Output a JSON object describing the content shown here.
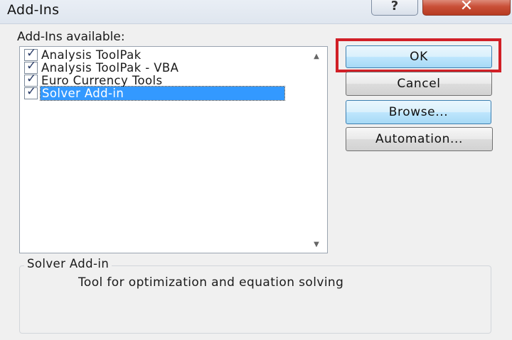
{
  "window": {
    "title": "Add-Ins",
    "help_glyph": "?",
    "close_glyph": "✕"
  },
  "addins": {
    "label": "Add-Ins available:",
    "items": [
      {
        "label": "Analysis ToolPak",
        "checked": true,
        "selected": false
      },
      {
        "label": "Analysis ToolPak - VBA",
        "checked": true,
        "selected": false
      },
      {
        "label": "Euro Currency Tools",
        "checked": true,
        "selected": false
      },
      {
        "label": "Solver Add-in",
        "checked": true,
        "selected": true
      }
    ],
    "check_glyph": "✓",
    "scroll_up_glyph": "▲",
    "scroll_down_glyph": "▼"
  },
  "buttons": {
    "ok": "OK",
    "cancel": "Cancel",
    "browse": "Browse...",
    "automation": "Automation..."
  },
  "description": {
    "title": "Solver Add-in",
    "text": "Tool for optimization and equation solving"
  },
  "colors": {
    "selection": "#3399ff",
    "highlight_box": "#d11f26",
    "close_button": "#c94f37"
  }
}
